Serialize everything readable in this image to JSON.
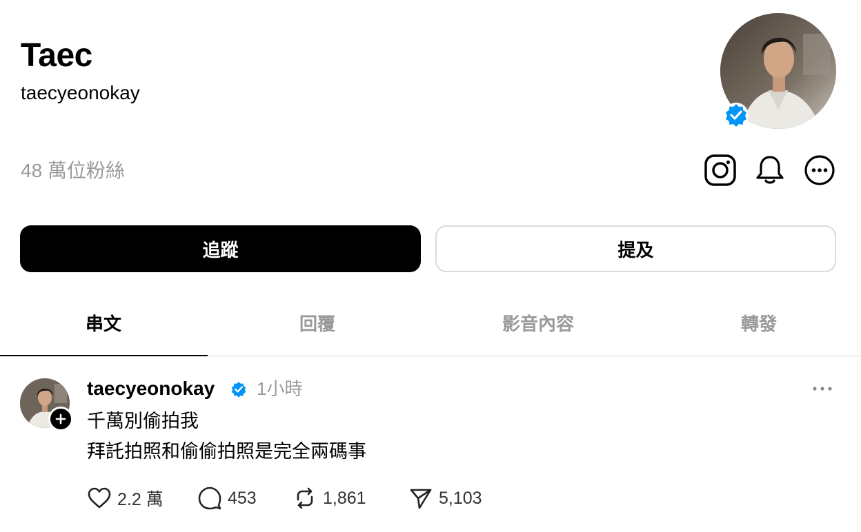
{
  "profile": {
    "display_name": "Taec",
    "username": "taecyeonokay",
    "followers": "48 萬位粉絲"
  },
  "buttons": {
    "follow": "追蹤",
    "mention": "提及"
  },
  "tabs": [
    {
      "label": "串文",
      "active": true
    },
    {
      "label": "回覆",
      "active": false
    },
    {
      "label": "影音內容",
      "active": false
    },
    {
      "label": "轉發",
      "active": false
    }
  ],
  "post": {
    "username": "taecyeonokay",
    "time": "1小時",
    "lines": [
      "千萬別偷拍我",
      "拜託拍照和偷偷拍照是完全兩碼事"
    ],
    "stats": {
      "likes": "2.2 萬",
      "replies": "453",
      "reposts": "1,861",
      "shares": "5,103"
    }
  },
  "colors": {
    "verified": "#0095f6",
    "secondary_text": "#999999",
    "divider": "#d6d6d6"
  },
  "icons": [
    "instagram-icon",
    "bell-icon",
    "more-icon",
    "verified-icon",
    "heart-icon",
    "comment-icon",
    "repost-icon",
    "share-icon"
  ]
}
